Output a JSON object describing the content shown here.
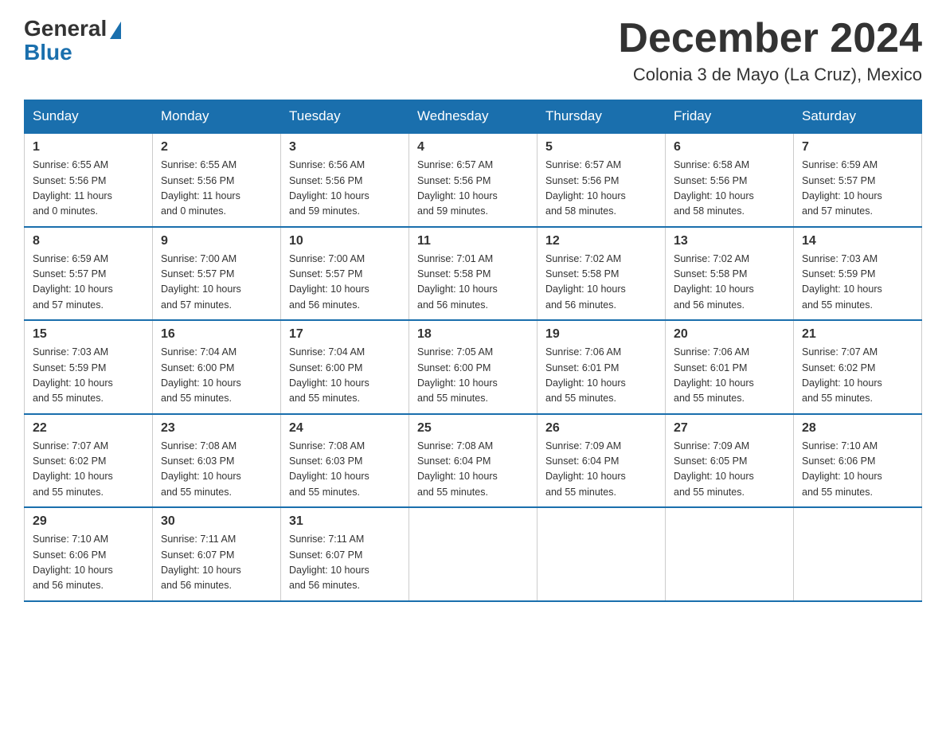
{
  "logo": {
    "general": "General",
    "blue": "Blue"
  },
  "header": {
    "month": "December 2024",
    "location": "Colonia 3 de Mayo (La Cruz), Mexico"
  },
  "days_of_week": [
    "Sunday",
    "Monday",
    "Tuesday",
    "Wednesday",
    "Thursday",
    "Friday",
    "Saturday"
  ],
  "weeks": [
    [
      {
        "day": "1",
        "sunrise": "6:55 AM",
        "sunset": "5:56 PM",
        "daylight": "11 hours and 0 minutes."
      },
      {
        "day": "2",
        "sunrise": "6:55 AM",
        "sunset": "5:56 PM",
        "daylight": "11 hours and 0 minutes."
      },
      {
        "day": "3",
        "sunrise": "6:56 AM",
        "sunset": "5:56 PM",
        "daylight": "10 hours and 59 minutes."
      },
      {
        "day": "4",
        "sunrise": "6:57 AM",
        "sunset": "5:56 PM",
        "daylight": "10 hours and 59 minutes."
      },
      {
        "day": "5",
        "sunrise": "6:57 AM",
        "sunset": "5:56 PM",
        "daylight": "10 hours and 58 minutes."
      },
      {
        "day": "6",
        "sunrise": "6:58 AM",
        "sunset": "5:56 PM",
        "daylight": "10 hours and 58 minutes."
      },
      {
        "day": "7",
        "sunrise": "6:59 AM",
        "sunset": "5:57 PM",
        "daylight": "10 hours and 57 minutes."
      }
    ],
    [
      {
        "day": "8",
        "sunrise": "6:59 AM",
        "sunset": "5:57 PM",
        "daylight": "10 hours and 57 minutes."
      },
      {
        "day": "9",
        "sunrise": "7:00 AM",
        "sunset": "5:57 PM",
        "daylight": "10 hours and 57 minutes."
      },
      {
        "day": "10",
        "sunrise": "7:00 AM",
        "sunset": "5:57 PM",
        "daylight": "10 hours and 56 minutes."
      },
      {
        "day": "11",
        "sunrise": "7:01 AM",
        "sunset": "5:58 PM",
        "daylight": "10 hours and 56 minutes."
      },
      {
        "day": "12",
        "sunrise": "7:02 AM",
        "sunset": "5:58 PM",
        "daylight": "10 hours and 56 minutes."
      },
      {
        "day": "13",
        "sunrise": "7:02 AM",
        "sunset": "5:58 PM",
        "daylight": "10 hours and 56 minutes."
      },
      {
        "day": "14",
        "sunrise": "7:03 AM",
        "sunset": "5:59 PM",
        "daylight": "10 hours and 55 minutes."
      }
    ],
    [
      {
        "day": "15",
        "sunrise": "7:03 AM",
        "sunset": "5:59 PM",
        "daylight": "10 hours and 55 minutes."
      },
      {
        "day": "16",
        "sunrise": "7:04 AM",
        "sunset": "6:00 PM",
        "daylight": "10 hours and 55 minutes."
      },
      {
        "day": "17",
        "sunrise": "7:04 AM",
        "sunset": "6:00 PM",
        "daylight": "10 hours and 55 minutes."
      },
      {
        "day": "18",
        "sunrise": "7:05 AM",
        "sunset": "6:00 PM",
        "daylight": "10 hours and 55 minutes."
      },
      {
        "day": "19",
        "sunrise": "7:06 AM",
        "sunset": "6:01 PM",
        "daylight": "10 hours and 55 minutes."
      },
      {
        "day": "20",
        "sunrise": "7:06 AM",
        "sunset": "6:01 PM",
        "daylight": "10 hours and 55 minutes."
      },
      {
        "day": "21",
        "sunrise": "7:07 AM",
        "sunset": "6:02 PM",
        "daylight": "10 hours and 55 minutes."
      }
    ],
    [
      {
        "day": "22",
        "sunrise": "7:07 AM",
        "sunset": "6:02 PM",
        "daylight": "10 hours and 55 minutes."
      },
      {
        "day": "23",
        "sunrise": "7:08 AM",
        "sunset": "6:03 PM",
        "daylight": "10 hours and 55 minutes."
      },
      {
        "day": "24",
        "sunrise": "7:08 AM",
        "sunset": "6:03 PM",
        "daylight": "10 hours and 55 minutes."
      },
      {
        "day": "25",
        "sunrise": "7:08 AM",
        "sunset": "6:04 PM",
        "daylight": "10 hours and 55 minutes."
      },
      {
        "day": "26",
        "sunrise": "7:09 AM",
        "sunset": "6:04 PM",
        "daylight": "10 hours and 55 minutes."
      },
      {
        "day": "27",
        "sunrise": "7:09 AM",
        "sunset": "6:05 PM",
        "daylight": "10 hours and 55 minutes."
      },
      {
        "day": "28",
        "sunrise": "7:10 AM",
        "sunset": "6:06 PM",
        "daylight": "10 hours and 55 minutes."
      }
    ],
    [
      {
        "day": "29",
        "sunrise": "7:10 AM",
        "sunset": "6:06 PM",
        "daylight": "10 hours and 56 minutes."
      },
      {
        "day": "30",
        "sunrise": "7:11 AM",
        "sunset": "6:07 PM",
        "daylight": "10 hours and 56 minutes."
      },
      {
        "day": "31",
        "sunrise": "7:11 AM",
        "sunset": "6:07 PM",
        "daylight": "10 hours and 56 minutes."
      },
      null,
      null,
      null,
      null
    ]
  ],
  "labels": {
    "sunrise": "Sunrise:",
    "sunset": "Sunset:",
    "daylight": "Daylight:"
  }
}
